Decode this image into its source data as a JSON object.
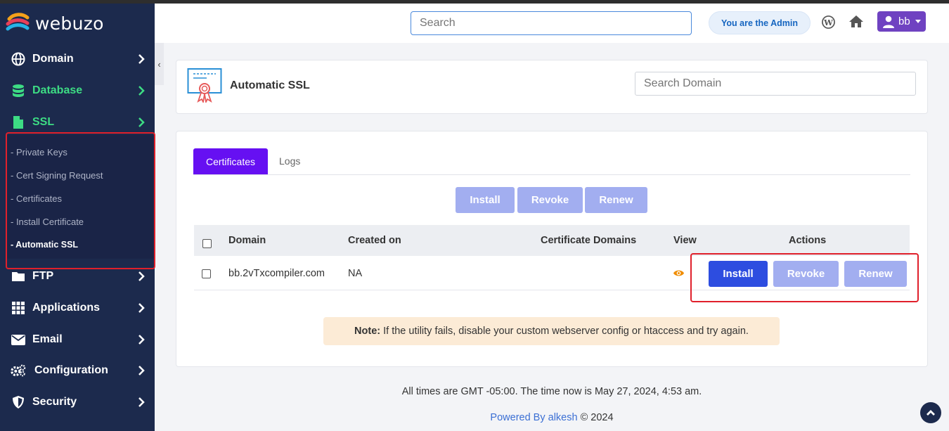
{
  "app": {
    "name": "webuzo"
  },
  "header": {
    "search_placeholder": "Search",
    "admin_label": "You are the Admin",
    "user_name": "bb"
  },
  "sidebar": {
    "items": [
      {
        "label": "Domain",
        "icon": "globe-icon"
      },
      {
        "label": "Database",
        "icon": "database-icon"
      },
      {
        "label": "SSL",
        "icon": "file-icon"
      },
      {
        "label": "FTP",
        "icon": "folder-icon"
      },
      {
        "label": "Applications",
        "icon": "grid-icon"
      },
      {
        "label": "Email",
        "icon": "envelope-icon"
      },
      {
        "label": "Configuration",
        "icon": "gears-icon"
      },
      {
        "label": "Security",
        "icon": "shield-icon"
      }
    ],
    "ssl_subitems": [
      "- Private Keys",
      "- Cert Signing Request",
      "- Certificates",
      "- Install Certificate",
      "- Automatic SSL"
    ],
    "active_color": "#3ddc84"
  },
  "page": {
    "title": "Automatic SSL",
    "search_domain_placeholder": "Search Domain",
    "tabs": [
      "Certificates",
      "Logs"
    ],
    "bulk_buttons": [
      "Install",
      "Revoke",
      "Renew"
    ],
    "table": {
      "columns": [
        "Domain",
        "Created on",
        "Certificate Domains",
        "View",
        "Actions"
      ],
      "rows": [
        {
          "domain": "bb.2vTxcompiler.com",
          "created_on": "NA",
          "certificate_domains": "",
          "actions": [
            "Install",
            "Revoke",
            "Renew"
          ]
        }
      ]
    },
    "note_label": "Note:",
    "note_text": "If the utility fails, disable your custom webserver config or htaccess and try again."
  },
  "footer": {
    "time_text": "All times are GMT -05:00. The time now is May 27, 2024, 4:53 am.",
    "powered_prefix": "Powered By",
    "powered_link": "alkesh",
    "copyright": "© 2024"
  },
  "colors": {
    "sidebar_bg": "#1c2a4d",
    "tab_active": "#6610f2",
    "primary_button": "#2d4de0",
    "disabled_button": "#a2aef0",
    "highlight_box": "#e0202b",
    "note_bg": "#fcebd6"
  }
}
